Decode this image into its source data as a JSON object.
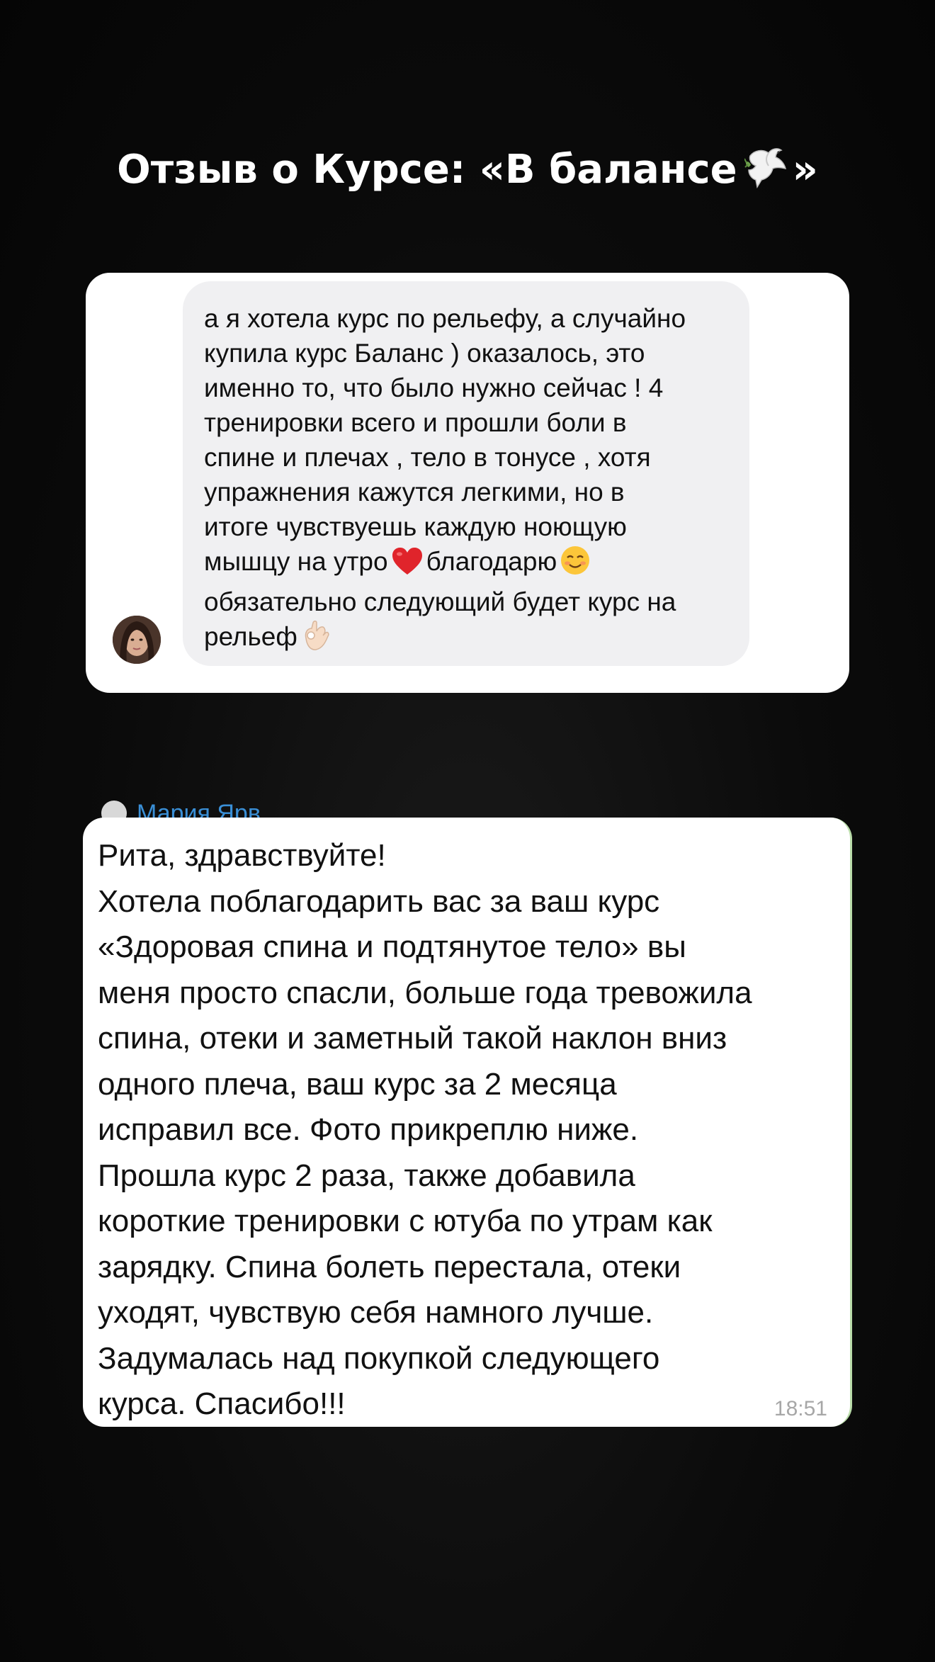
{
  "title": {
    "text_before": "Отзыв о Курсе: «В балансе",
    "text_after": "»",
    "icon": "dove-icon"
  },
  "review1": {
    "avatar_icon": "user-avatar",
    "lines": [
      "а я хотела курс по рельефу, а случайно",
      "купила курс  Баланс ) оказалось, это",
      "именно то, что было нужно сейчас ! 4",
      "тренировки всего и прошли боли в",
      "спине и плечах , тело в тонусе , хотя",
      "упражнения кажутся легкими, но в",
      "итоге чувствуешь каждую ноющую"
    ],
    "line8_part1": "мышцу на утро",
    "line8_icon": "red-heart-icon",
    "line8_part2": "благодарю",
    "line8_icon2": "smiling-face-icon",
    "line9": "обязательно следующий будет курс на",
    "line10": "рельеф",
    "line10_icon": "ok-hand-icon"
  },
  "review2": {
    "sender_name": "Мария Ярв",
    "lines": [
      "Рита, здравствуйте!",
      "Хотела поблагодарить вас за ваш курс",
      "«Здоровая спина и подтянутое тело» вы",
      "меня просто спасли, больше года тревожила",
      "спина, отеки и заметный такой наклон вниз",
      "одного плеча, ваш курс за 2 месяца",
      "исправил все. Фото прикреплю ниже.",
      "Прошла курс 2 раза, также добавила",
      "короткие тренировки с ютуба по утрам как",
      "зарядку. Спина болеть перестала, отеки",
      "уходят, чувствую себя намного лучше.",
      "Задумалась над покупкой следующего",
      "курса. Спасибо!!!"
    ],
    "time": "18:51"
  },
  "colors": {
    "background": "#0b0b0b",
    "card": "#ffffff",
    "bubble": "#f0f0f2",
    "sender_name": "#3a8fd6",
    "timestamp": "#a7a7a7",
    "heart": "#e0242b"
  }
}
